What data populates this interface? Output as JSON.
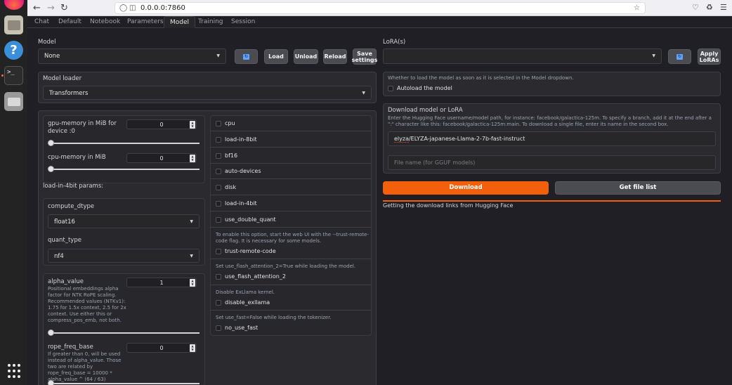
{
  "browser": {
    "url": "0.0.0.0:7860"
  },
  "tabs": [
    "Chat",
    "Default",
    "Notebook",
    "Parameters",
    "Model",
    "Training",
    "Session"
  ],
  "active_tab": "Model",
  "model": {
    "label": "Model",
    "selected": "None",
    "load": "Load",
    "unload": "Unload",
    "reload": "Reload",
    "save_settings": "Save settings"
  },
  "loader": {
    "label": "Model loader",
    "selected": "Transformers"
  },
  "gpu_memory": {
    "label": "gpu-memory in MiB for device :0",
    "value": "0"
  },
  "cpu_memory": {
    "label": "cpu-memory in MiB",
    "value": "0"
  },
  "load_4bit_params": "load-in-4bit params:",
  "compute_dtype": {
    "label": "compute_dtype",
    "selected": "float16"
  },
  "quant_type": {
    "label": "quant_type",
    "selected": "nf4"
  },
  "alpha_value": {
    "label": "alpha_value",
    "info": "Positional embeddings alpha factor for NTK RoPE scaling. Recommended values (NTKv1): 1.75 for 1.5x context, 2.5 for 2x context. Use either this or compress_pos_emb, not both.",
    "value": "1"
  },
  "rope_freq_base": {
    "label": "rope_freq_base",
    "info": "If greater than 0, will be used instead of alpha_value. Those two are related by rope_freq_base = 10000 * alpha_value ^ (64 / 63)",
    "value": "0"
  },
  "checkboxes": {
    "cpu": "cpu",
    "load_in_8bit": "load-in-8bit",
    "bf16": "bf16",
    "auto_devices": "auto-devices",
    "disk": "disk",
    "load_in_4bit": "load-in-4bit",
    "use_double_quant": "use_double_quant",
    "trust_info": "To enable this option, start the web UI with the --trust-remote-code flag. It is necessary for some models.",
    "trust_remote_code": "trust-remote-code",
    "flash_info": "Set use_flash_attention_2=True while loading the model.",
    "use_flash_attention_2": "use_flash_attention_2",
    "exllama_info": "Disable ExLlama kernel.",
    "disable_exllama": "disable_exllama",
    "fast_info": "Set use_fast=False while loading the tokenizer.",
    "no_use_fast": "no_use_fast"
  },
  "lora": {
    "label": "LoRA(s)",
    "apply": "Apply LoRAs"
  },
  "autoload": {
    "info": "Whether to load the model as soon as it is selected in the Model dropdown.",
    "label": "Autoload the model"
  },
  "download": {
    "title": "Download model or LoRA",
    "info": "Enter the Hugging Face username/model path, for instance: facebook/galactica-125m. To specify a branch, add it at the end after a \":\" character like this: facebook/galactica-125m:main. To download a single file, enter its name in the second box.",
    "repo_prefix": "elyza",
    "repo_rest": "/ELYZA-japanese-Llama-2-7b-fast-instruct",
    "filename_placeholder": "File name (for GGUF models)",
    "download_button": "Download",
    "file_list_button": "Get file list",
    "status": "Getting the download links from Hugging Face"
  },
  "colors": {
    "accent": "#f2600c",
    "background": "#1f1f25",
    "panel": "#2a2a2f"
  }
}
